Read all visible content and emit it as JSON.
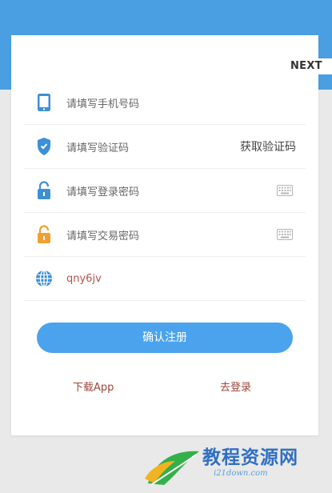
{
  "header": {
    "next_label": "NEXT"
  },
  "form": {
    "phone_placeholder": "请填写手机号码",
    "code_placeholder": "请填写验证码",
    "get_code_label": "获取验证码",
    "login_password_placeholder": "请填写登录密码",
    "trade_password_placeholder": "请填写交易密码",
    "invite_code_value": "qny6jv"
  },
  "actions": {
    "register_label": "确认注册",
    "download_label": "下载App",
    "login_label": "去登录"
  },
  "watermark": {
    "text": "教程资源网",
    "url": "i21down.com"
  },
  "colors": {
    "primary": "#4aa3ec",
    "top_band": "#4a9fe3",
    "link": "#a0443a",
    "lock_blue": "#3d8fd6",
    "lock_orange": "#f0a030"
  },
  "icons": [
    "phone-icon",
    "shield-icon",
    "lock-icon",
    "lock-icon",
    "globe-icon",
    "keyboard-icon"
  ]
}
